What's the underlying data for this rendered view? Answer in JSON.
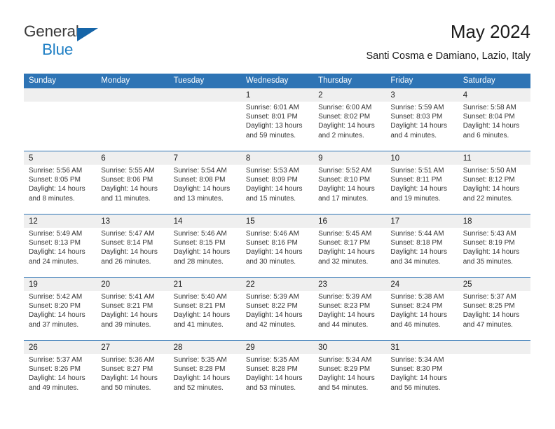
{
  "brand": {
    "name_part1": "General",
    "name_part2": "Blue",
    "triangle_icon": "triangle-icon",
    "colors": {
      "dark": "#3b3b3b",
      "blue": "#1f7fc4",
      "triangle": "#1665a8"
    }
  },
  "header": {
    "title": "May 2024",
    "subtitle": "Santi Cosma e Damiano, Lazio, Italy"
  },
  "theme": {
    "header_blue": "#2e74b5",
    "daynum_gray": "#efefef",
    "body_white": "#ffffff"
  },
  "weekdays": [
    "Sunday",
    "Monday",
    "Tuesday",
    "Wednesday",
    "Thursday",
    "Friday",
    "Saturday"
  ],
  "weeks": [
    {
      "days": [
        {
          "num": "",
          "lines": []
        },
        {
          "num": "",
          "lines": []
        },
        {
          "num": "",
          "lines": []
        },
        {
          "num": "1",
          "lines": [
            "Sunrise: 6:01 AM",
            "Sunset: 8:01 PM",
            "Daylight: 13 hours",
            "and 59 minutes."
          ]
        },
        {
          "num": "2",
          "lines": [
            "Sunrise: 6:00 AM",
            "Sunset: 8:02 PM",
            "Daylight: 14 hours",
            "and 2 minutes."
          ]
        },
        {
          "num": "3",
          "lines": [
            "Sunrise: 5:59 AM",
            "Sunset: 8:03 PM",
            "Daylight: 14 hours",
            "and 4 minutes."
          ]
        },
        {
          "num": "4",
          "lines": [
            "Sunrise: 5:58 AM",
            "Sunset: 8:04 PM",
            "Daylight: 14 hours",
            "and 6 minutes."
          ]
        }
      ]
    },
    {
      "days": [
        {
          "num": "5",
          "lines": [
            "Sunrise: 5:56 AM",
            "Sunset: 8:05 PM",
            "Daylight: 14 hours",
            "and 8 minutes."
          ]
        },
        {
          "num": "6",
          "lines": [
            "Sunrise: 5:55 AM",
            "Sunset: 8:06 PM",
            "Daylight: 14 hours",
            "and 11 minutes."
          ]
        },
        {
          "num": "7",
          "lines": [
            "Sunrise: 5:54 AM",
            "Sunset: 8:08 PM",
            "Daylight: 14 hours",
            "and 13 minutes."
          ]
        },
        {
          "num": "8",
          "lines": [
            "Sunrise: 5:53 AM",
            "Sunset: 8:09 PM",
            "Daylight: 14 hours",
            "and 15 minutes."
          ]
        },
        {
          "num": "9",
          "lines": [
            "Sunrise: 5:52 AM",
            "Sunset: 8:10 PM",
            "Daylight: 14 hours",
            "and 17 minutes."
          ]
        },
        {
          "num": "10",
          "lines": [
            "Sunrise: 5:51 AM",
            "Sunset: 8:11 PM",
            "Daylight: 14 hours",
            "and 19 minutes."
          ]
        },
        {
          "num": "11",
          "lines": [
            "Sunrise: 5:50 AM",
            "Sunset: 8:12 PM",
            "Daylight: 14 hours",
            "and 22 minutes."
          ]
        }
      ]
    },
    {
      "days": [
        {
          "num": "12",
          "lines": [
            "Sunrise: 5:49 AM",
            "Sunset: 8:13 PM",
            "Daylight: 14 hours",
            "and 24 minutes."
          ]
        },
        {
          "num": "13",
          "lines": [
            "Sunrise: 5:47 AM",
            "Sunset: 8:14 PM",
            "Daylight: 14 hours",
            "and 26 minutes."
          ]
        },
        {
          "num": "14",
          "lines": [
            "Sunrise: 5:46 AM",
            "Sunset: 8:15 PM",
            "Daylight: 14 hours",
            "and 28 minutes."
          ]
        },
        {
          "num": "15",
          "lines": [
            "Sunrise: 5:46 AM",
            "Sunset: 8:16 PM",
            "Daylight: 14 hours",
            "and 30 minutes."
          ]
        },
        {
          "num": "16",
          "lines": [
            "Sunrise: 5:45 AM",
            "Sunset: 8:17 PM",
            "Daylight: 14 hours",
            "and 32 minutes."
          ]
        },
        {
          "num": "17",
          "lines": [
            "Sunrise: 5:44 AM",
            "Sunset: 8:18 PM",
            "Daylight: 14 hours",
            "and 34 minutes."
          ]
        },
        {
          "num": "18",
          "lines": [
            "Sunrise: 5:43 AM",
            "Sunset: 8:19 PM",
            "Daylight: 14 hours",
            "and 35 minutes."
          ]
        }
      ]
    },
    {
      "days": [
        {
          "num": "19",
          "lines": [
            "Sunrise: 5:42 AM",
            "Sunset: 8:20 PM",
            "Daylight: 14 hours",
            "and 37 minutes."
          ]
        },
        {
          "num": "20",
          "lines": [
            "Sunrise: 5:41 AM",
            "Sunset: 8:21 PM",
            "Daylight: 14 hours",
            "and 39 minutes."
          ]
        },
        {
          "num": "21",
          "lines": [
            "Sunrise: 5:40 AM",
            "Sunset: 8:21 PM",
            "Daylight: 14 hours",
            "and 41 minutes."
          ]
        },
        {
          "num": "22",
          "lines": [
            "Sunrise: 5:39 AM",
            "Sunset: 8:22 PM",
            "Daylight: 14 hours",
            "and 42 minutes."
          ]
        },
        {
          "num": "23",
          "lines": [
            "Sunrise: 5:39 AM",
            "Sunset: 8:23 PM",
            "Daylight: 14 hours",
            "and 44 minutes."
          ]
        },
        {
          "num": "24",
          "lines": [
            "Sunrise: 5:38 AM",
            "Sunset: 8:24 PM",
            "Daylight: 14 hours",
            "and 46 minutes."
          ]
        },
        {
          "num": "25",
          "lines": [
            "Sunrise: 5:37 AM",
            "Sunset: 8:25 PM",
            "Daylight: 14 hours",
            "and 47 minutes."
          ]
        }
      ]
    },
    {
      "days": [
        {
          "num": "26",
          "lines": [
            "Sunrise: 5:37 AM",
            "Sunset: 8:26 PM",
            "Daylight: 14 hours",
            "and 49 minutes."
          ]
        },
        {
          "num": "27",
          "lines": [
            "Sunrise: 5:36 AM",
            "Sunset: 8:27 PM",
            "Daylight: 14 hours",
            "and 50 minutes."
          ]
        },
        {
          "num": "28",
          "lines": [
            "Sunrise: 5:35 AM",
            "Sunset: 8:28 PM",
            "Daylight: 14 hours",
            "and 52 minutes."
          ]
        },
        {
          "num": "29",
          "lines": [
            "Sunrise: 5:35 AM",
            "Sunset: 8:28 PM",
            "Daylight: 14 hours",
            "and 53 minutes."
          ]
        },
        {
          "num": "30",
          "lines": [
            "Sunrise: 5:34 AM",
            "Sunset: 8:29 PM",
            "Daylight: 14 hours",
            "and 54 minutes."
          ]
        },
        {
          "num": "31",
          "lines": [
            "Sunrise: 5:34 AM",
            "Sunset: 8:30 PM",
            "Daylight: 14 hours",
            "and 56 minutes."
          ]
        },
        {
          "num": "",
          "lines": []
        }
      ]
    }
  ]
}
